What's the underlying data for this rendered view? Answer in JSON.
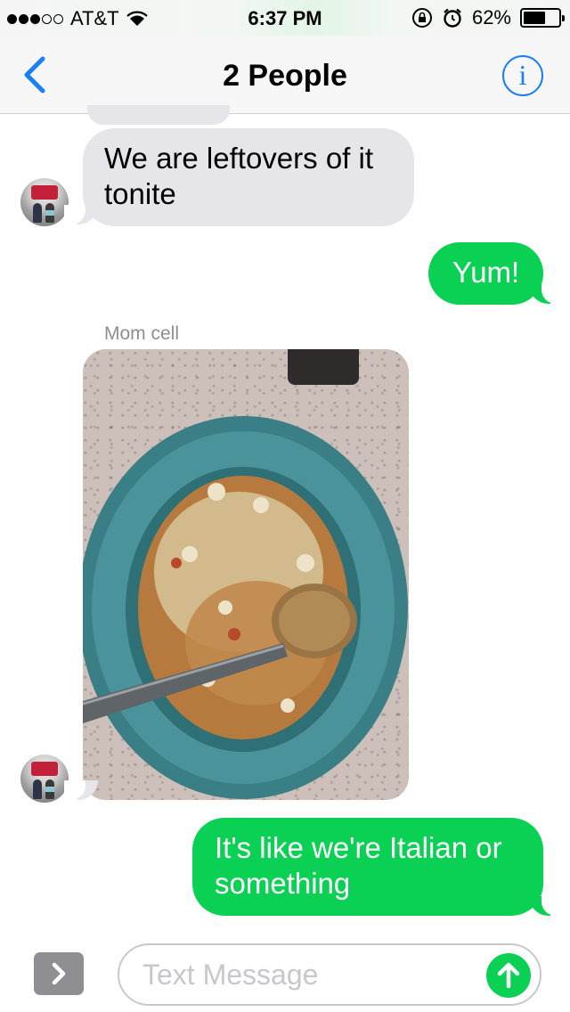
{
  "status_bar": {
    "carrier": "AT&T",
    "time": "6:37 PM",
    "battery_percent": "62%",
    "battery_level": 0.62,
    "signal_bars_filled": 3,
    "signal_bars_total": 5
  },
  "nav": {
    "title": "2 People",
    "info_glyph": "i",
    "back_icon": "chevron-left-icon"
  },
  "conversation": {
    "incoming_1": {
      "text": "We are leftovers of it tonite"
    },
    "outgoing_1": {
      "text": "Yum!"
    },
    "sender_label": "Mom cell",
    "incoming_photo": {
      "description_icon": "photo"
    },
    "outgoing_2": {
      "text": "It's like we're Italian or something"
    }
  },
  "composer": {
    "placeholder": "Text Message",
    "value": ""
  },
  "colors": {
    "incoming_bubble": "#e5e5ea",
    "outgoing_bubble": "#0ad154",
    "ios_blue": "#1a7ef5",
    "bowl_teal": "#3f8a8f"
  }
}
